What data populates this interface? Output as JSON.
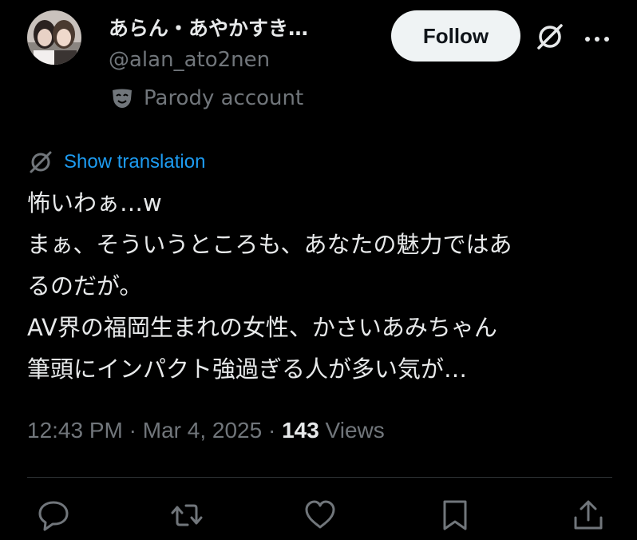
{
  "author": {
    "display_name": "あらん・あやかすき…",
    "handle": "@alan_ato2nen",
    "avatar_icon": "avatar"
  },
  "header": {
    "follow_label": "Follow",
    "grok_icon": "grok-icon",
    "more_icon": "more-icon"
  },
  "parody": {
    "label": "Parody account",
    "icon": "mask-icon"
  },
  "translation": {
    "label": "Show translation",
    "icon": "grok-icon"
  },
  "tweet": {
    "lines": [
      "怖いわぁ…w",
      "まぁ、そういうところも、あなたの魅力ではあ",
      "るのだが。",
      "AV界の福岡生まれの女性、かさいあみちゃん",
      "筆頭にインパクト強過ぎる人が多い気が…"
    ]
  },
  "meta": {
    "time": "12:43 PM",
    "separator": " · ",
    "date": "Mar 4, 2025",
    "views_count": "143",
    "views_label": " Views"
  },
  "actions": {
    "reply_icon": "reply-icon",
    "repost_icon": "repost-icon",
    "like_icon": "heart-icon",
    "bookmark_icon": "bookmark-icon",
    "share_icon": "share-icon"
  },
  "colors": {
    "background": "#000000",
    "text": "#e7e9ea",
    "secondary": "#71767b",
    "accent": "#1d9bf0",
    "follow_bg": "#eff3f4",
    "divider": "#2f3336"
  }
}
